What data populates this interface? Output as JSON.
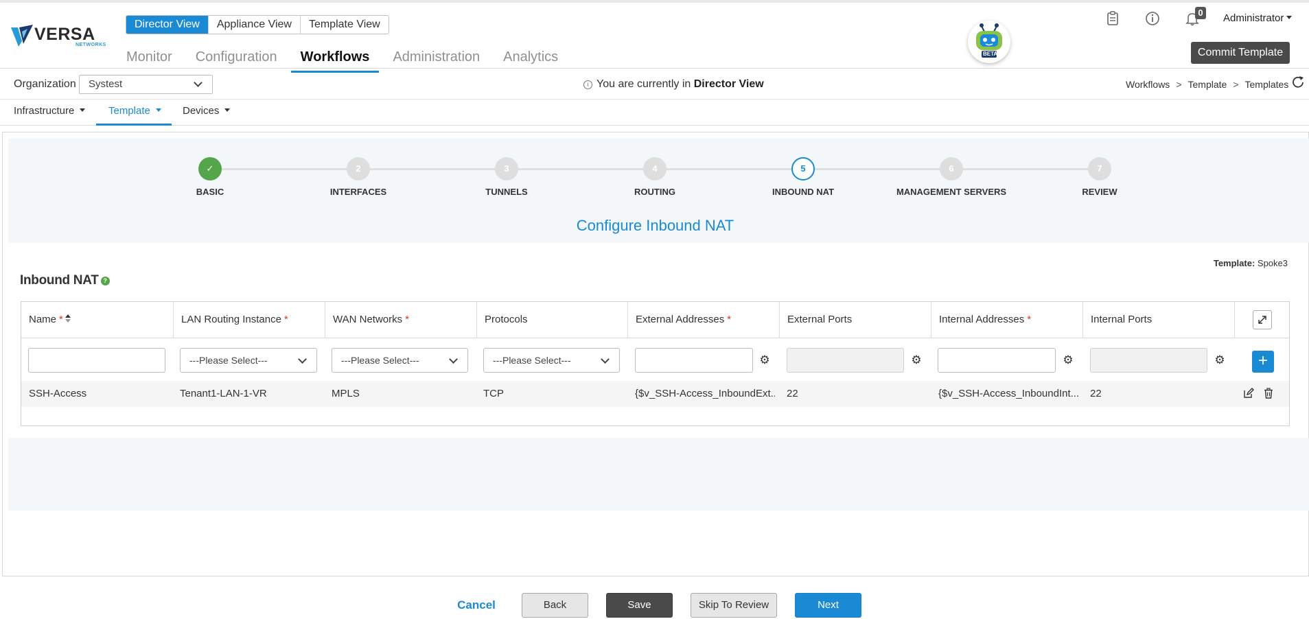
{
  "header": {
    "logo_text": "VERSA",
    "logo_sub": "NETWORKS",
    "views": [
      "Director View",
      "Appliance View",
      "Template View"
    ],
    "main_nav": [
      "Monitor",
      "Configuration",
      "Workflows",
      "Administration",
      "Analytics"
    ],
    "bot_badge": "BETA",
    "notification_count": "0",
    "user": "Administrator",
    "commit_label": "Commit Template"
  },
  "orgbar": {
    "label": "Organization",
    "selected": "Systest",
    "note_prefix": "You are currently in",
    "note_view": "Director View",
    "breadcrumb": [
      "Workflows",
      "Template",
      "Templates"
    ],
    "breadcrumb_sep": ">"
  },
  "subnav": [
    "Infrastructure",
    "Template",
    "Devices"
  ],
  "wizard": {
    "steps": [
      {
        "num": "1",
        "label": "BASIC",
        "state": "done"
      },
      {
        "num": "2",
        "label": "INTERFACES",
        "state": "pending"
      },
      {
        "num": "3",
        "label": "TUNNELS",
        "state": "pending"
      },
      {
        "num": "4",
        "label": "ROUTING",
        "state": "pending"
      },
      {
        "num": "5",
        "label": "INBOUND NAT",
        "state": "current"
      },
      {
        "num": "6",
        "label": "MANAGEMENT SERVERS",
        "state": "pending"
      },
      {
        "num": "7",
        "label": "REVIEW",
        "state": "pending"
      }
    ],
    "title": "Configure Inbound NAT",
    "done_mark": "✓"
  },
  "template_info": {
    "label": "Template:",
    "value": "Spoke3"
  },
  "section": {
    "title": "Inbound NAT",
    "help": "?"
  },
  "table": {
    "columns": [
      {
        "label": "Name",
        "required": true
      },
      {
        "label": "LAN Routing Instance",
        "required": true
      },
      {
        "label": "WAN Networks",
        "required": true
      },
      {
        "label": "Protocols",
        "required": false
      },
      {
        "label": "External Addresses",
        "required": true
      },
      {
        "label": "External Ports",
        "required": false
      },
      {
        "label": "Internal Addresses",
        "required": true
      },
      {
        "label": "Internal Ports",
        "required": false
      }
    ],
    "required_mark": "*",
    "select_placeholder": "---Please Select---",
    "rows": [
      {
        "name": "SSH-Access",
        "lan_routing_instance": "Tenant1-LAN-1-VR",
        "wan_networks": "MPLS",
        "protocols": "TCP",
        "external_addresses": "{$v_SSH-Access_InboundExt...",
        "external_ports": "22",
        "internal_addresses": "{$v_SSH-Access_InboundInt...",
        "internal_ports": "22"
      }
    ]
  },
  "footer": {
    "cancel": "Cancel",
    "back": "Back",
    "save": "Save",
    "skip": "Skip To Review",
    "next": "Next"
  },
  "colors": {
    "accent": "#1a8ad4",
    "done": "#55a54a",
    "dark_button": "#4a4a4a"
  }
}
